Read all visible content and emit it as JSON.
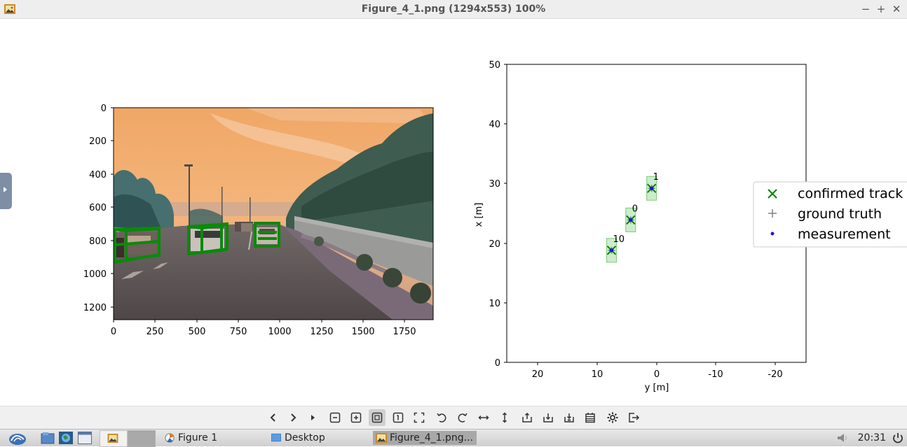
{
  "window": {
    "title": "Figure_4_1.png (1294x553) 100%"
  },
  "figure": {
    "camera": {
      "yticks": [
        "0",
        "200",
        "400",
        "600",
        "800",
        "1000",
        "1200"
      ],
      "xticks": [
        "0",
        "250",
        "500",
        "750",
        "1000",
        "1250",
        "1500",
        "1750"
      ]
    },
    "tracking": {
      "xlabel": "y [m]",
      "ylabel": "x [m]",
      "yticks": [
        "0",
        "10",
        "20",
        "30",
        "40",
        "50"
      ],
      "xticks": [
        "20",
        "10",
        "0",
        "-10",
        "-20"
      ],
      "legend": [
        {
          "label": "confirmed track",
          "marker": "x",
          "color": "#008000"
        },
        {
          "label": "ground truth",
          "marker": "+",
          "color": "#808080"
        },
        {
          "label": "measurement",
          "marker": "dot",
          "color": "#1a1ad0"
        }
      ]
    }
  },
  "chart_data": {
    "type": "scatter",
    "xlabel": "y [m]",
    "ylabel": "x [m]",
    "xlim": [
      25,
      -25
    ],
    "ylim": [
      0,
      50
    ],
    "legend_placement": "right",
    "tracks": [
      {
        "id": "1",
        "y": 0.8,
        "x": 29.2
      },
      {
        "id": "0",
        "y": 4.3,
        "x": 23.9
      },
      {
        "id": "10",
        "y": 7.5,
        "x": 18.8
      }
    ]
  },
  "toolbar": {
    "buttons": [
      {
        "name": "previous-button",
        "icon": "chevron-left-icon"
      },
      {
        "name": "next-button",
        "icon": "chevron-right-icon"
      },
      {
        "name": "play-button",
        "icon": "play-icon"
      },
      {
        "name": "zoom-out-button",
        "icon": "zoom-out-icon"
      },
      {
        "name": "zoom-in-button",
        "icon": "zoom-in-icon"
      },
      {
        "name": "fit-button",
        "icon": "fit-icon"
      },
      {
        "name": "original-size-button",
        "icon": "original-size-icon"
      },
      {
        "name": "fullscreen-button",
        "icon": "fullscreen-icon"
      },
      {
        "name": "rotate-left-button",
        "icon": "rotate-left-icon"
      },
      {
        "name": "rotate-right-button",
        "icon": "rotate-right-icon"
      },
      {
        "name": "flip-horizontal-button",
        "icon": "flip-horizontal-icon"
      },
      {
        "name": "flip-vertical-button",
        "icon": "flip-vertical-icon"
      },
      {
        "name": "open-button",
        "icon": "open-icon"
      },
      {
        "name": "save-button",
        "icon": "save-icon"
      },
      {
        "name": "save-as-button",
        "icon": "save-as-icon"
      },
      {
        "name": "delete-button",
        "icon": "delete-icon"
      },
      {
        "name": "preferences-button",
        "icon": "gear-icon"
      },
      {
        "name": "exit-button",
        "icon": "exit-icon"
      }
    ]
  },
  "taskbar": {
    "tasks": [
      {
        "label": "Figure 1"
      },
      {
        "label": "Desktop"
      },
      {
        "label": "Figure_4_1.png..."
      }
    ],
    "clock": "20:31"
  }
}
